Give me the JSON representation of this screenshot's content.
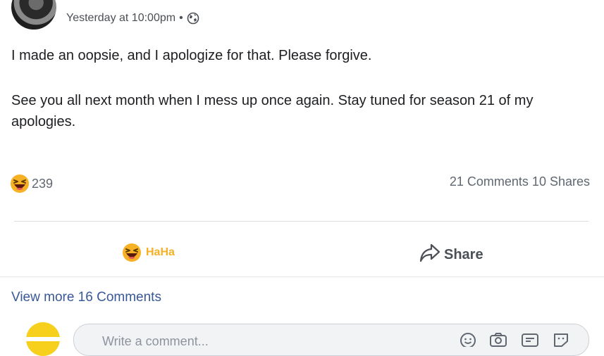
{
  "post": {
    "timestamp": "Yesterday at 10:00pm",
    "separator": "•",
    "privacy_icon": "globe-icon",
    "paragraphs": [
      "I made an oopsie, and I apologize for that. Please forgive.",
      "See you all next month when I mess up once again. Stay tuned for season 21 of my apologies."
    ]
  },
  "stats": {
    "reaction_icon": "haha-emoji-icon",
    "reaction_count": "239",
    "comments_shares": "21 Comments 10 Shares"
  },
  "actions": {
    "haha_label": "HaHa",
    "share_label": "Share"
  },
  "comments": {
    "view_more": "View more 16 Comments",
    "input_placeholder": "Write a comment...",
    "icons": [
      "emoji-icon",
      "camera-icon",
      "gif-icon",
      "sticker-icon"
    ]
  },
  "colors": {
    "link": "#385898",
    "haha": "#f7b125",
    "muted_text": "#606770"
  }
}
